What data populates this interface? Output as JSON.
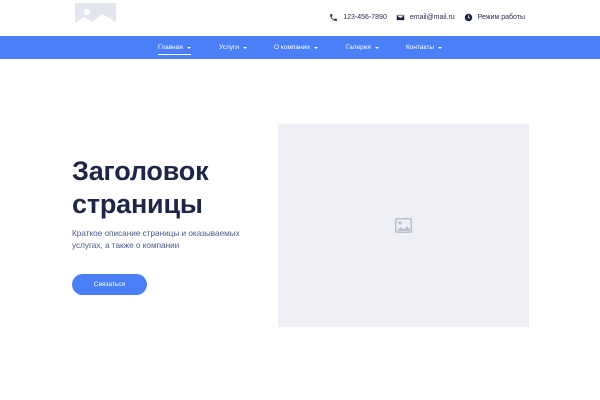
{
  "header": {
    "contacts": [
      {
        "icon": "phone-icon",
        "text": "123-456-7890"
      },
      {
        "icon": "envelope-icon",
        "text": "email@mail.ru"
      },
      {
        "icon": "clock-icon",
        "text": "Режим работы"
      }
    ]
  },
  "nav": {
    "items": [
      {
        "label": "Главная",
        "active": true
      },
      {
        "label": "Услуги"
      },
      {
        "label": "О компании"
      },
      {
        "label": "Галерея"
      },
      {
        "label": "Контакты"
      }
    ]
  },
  "hero": {
    "title_line1": "Заголовок",
    "title_line2": "страницы",
    "description": "Краткое описание страницы и оказываемых услугах, а также о компании",
    "button_label": "Связаться"
  },
  "colors": {
    "accent": "#4a7ff7",
    "title": "#1f2547",
    "text": "#4b5a8a",
    "placeholder_bg": "#eef0f5"
  }
}
